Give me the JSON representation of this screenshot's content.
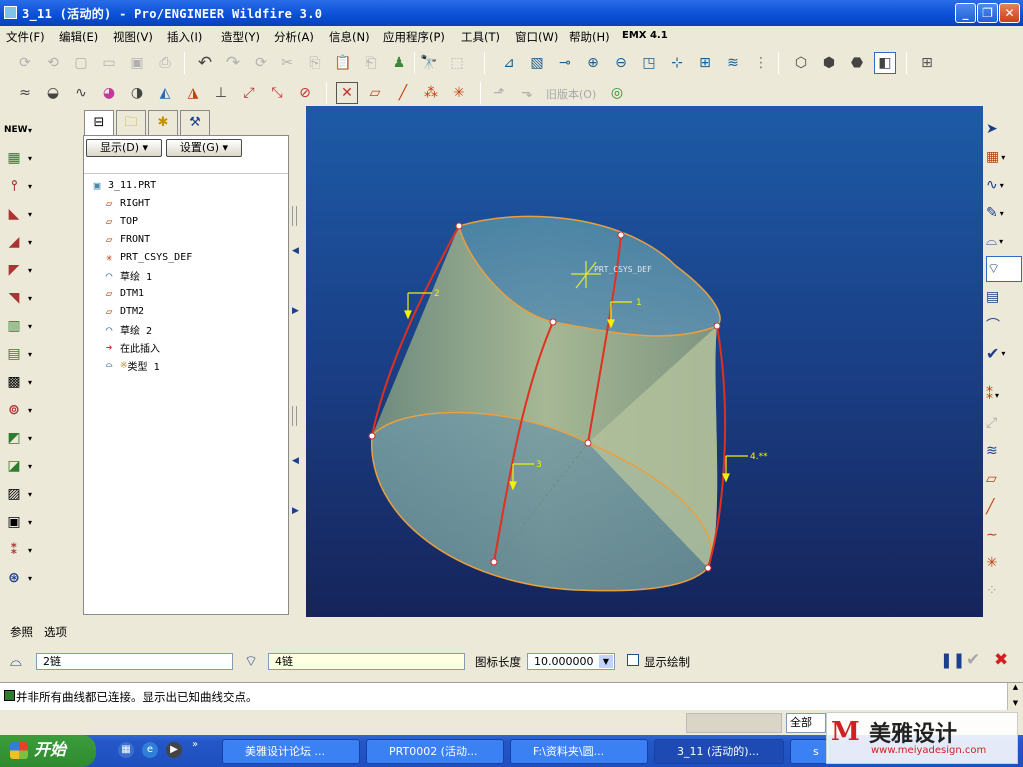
{
  "window": {
    "title": "3_11 (活动的) - Pro/ENGINEER Wildfire 3.0"
  },
  "menubar": {
    "items": [
      "文件(F)",
      "编辑(E)",
      "视图(V)",
      "插入(I)",
      "造型(Y)",
      "分析(A)",
      "信息(N)",
      "应用程序(P)",
      "工具(T)",
      "窗口(W)",
      "帮助(H)",
      "EMX 4.1"
    ]
  },
  "toolbar": {
    "old_version_label": "旧版本(O)"
  },
  "navigator": {
    "show_label": "显示(D)",
    "settings_label": "设置(G)",
    "tree": [
      {
        "label": "3_11.PRT",
        "icon": "part-icon"
      },
      {
        "label": "RIGHT",
        "icon": "datum-plane-icon"
      },
      {
        "label": "TOP",
        "icon": "datum-plane-icon"
      },
      {
        "label": "FRONT",
        "icon": "datum-plane-icon"
      },
      {
        "label": "PRT_CSYS_DEF",
        "icon": "csys-icon"
      },
      {
        "label": "草绘 1",
        "icon": "sketch-icon"
      },
      {
        "label": "DTM1",
        "icon": "datum-plane-icon"
      },
      {
        "label": "DTM2",
        "icon": "datum-plane-icon"
      },
      {
        "label": "草绘 2",
        "icon": "sketch-icon"
      },
      {
        "label": "在此插入",
        "icon": "insert-arrow-icon"
      },
      {
        "label": "类型 1",
        "icon": "boundary-blend-icon"
      }
    ]
  },
  "viewport": {
    "csys_label": "PRT_CSYS_DEF",
    "chain_labels": [
      "2",
      "1",
      "3",
      "4.**"
    ]
  },
  "dashboard": {
    "tab_reference": "参照",
    "tab_options": "选项",
    "first_dir_value": "2链",
    "second_dir_value": "4链",
    "icon_length_label": "图标长度",
    "icon_length_value": "10.000000",
    "show_drawing_label": "显示绘制"
  },
  "message": {
    "text": "并非所有曲线都已连接。显示出已知曲线交点。"
  },
  "status": {
    "filter_value": "全部"
  },
  "taskbar": {
    "start_label": "开始",
    "tasks": [
      "美雅设计论坛 ...",
      "PRT0002 (活动...",
      "F:\\资料夹\\圆...",
      "3_11 (活动的)...",
      "s"
    ]
  },
  "watermark": {
    "brand": "美雅设计",
    "url": "www.meiyadesign.com"
  },
  "colors": {
    "viewport_top": "#1d5ba7",
    "viewport_bottom": "#16245a",
    "surface": "#8fa88e",
    "curve": "#e0301e",
    "edge": "#e8a040",
    "label": "#f2f200"
  }
}
